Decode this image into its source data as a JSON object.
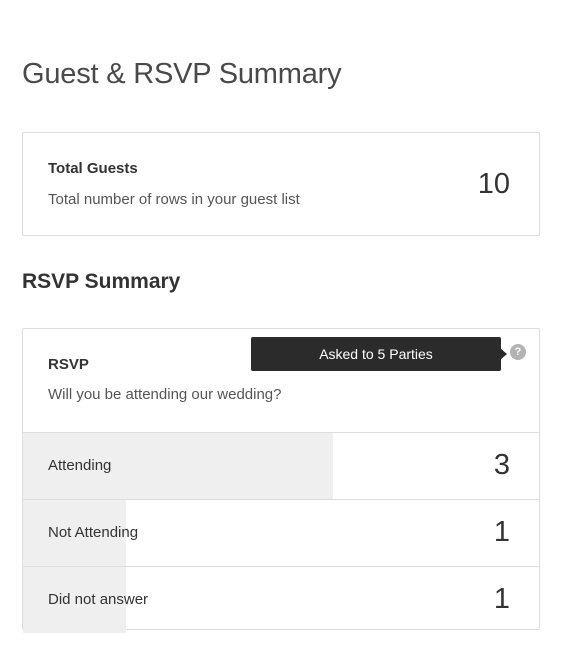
{
  "page": {
    "title": "Guest & RSVP Summary"
  },
  "total_guests": {
    "title": "Total Guests",
    "description": "Total number of rows in your guest list",
    "value": "10"
  },
  "rsvp_summary": {
    "section_title": "RSVP Summary",
    "question_title": "RSVP",
    "question_text": "Will you be attending our wedding?",
    "tooltip": "Asked to 5 Parties",
    "help_icon": "question-mark-icon",
    "bar_color": "#efefef",
    "rows": [
      {
        "label": "Attending",
        "count": "3",
        "share": 0.6
      },
      {
        "label": "Not Attending",
        "count": "1",
        "share": 0.2
      },
      {
        "label": "Did not answer",
        "count": "1",
        "share": 0.2
      }
    ]
  }
}
